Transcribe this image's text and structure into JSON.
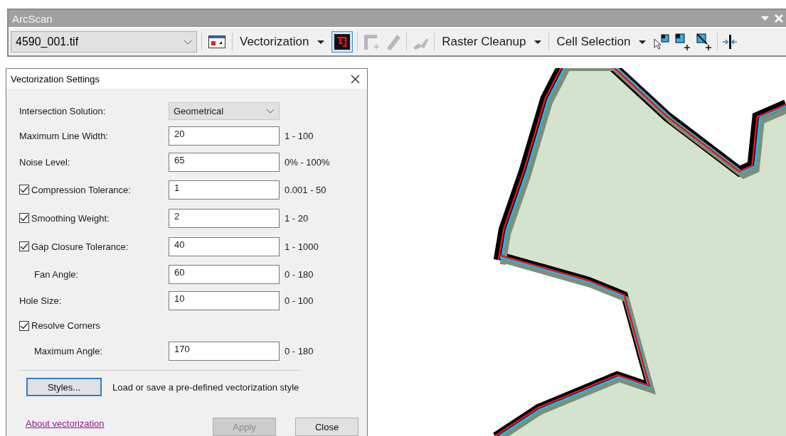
{
  "toolbar": {
    "title": "ArcScan",
    "raster": "4590_001.tif",
    "settings_button": {
      "selected": true
    },
    "menus": [
      {
        "label": "Vectorization"
      },
      {
        "label": "Raster Cleanup"
      },
      {
        "label": "Cell Selection"
      }
    ]
  },
  "dialog": {
    "title": "Vectorization Settings",
    "rows": [
      {
        "kind": "dropdown",
        "label": "Intersection Solution:",
        "value": "Geometrical"
      },
      {
        "kind": "field",
        "label": "Maximum Line Width:",
        "value": "20",
        "range": "1 - 100"
      },
      {
        "kind": "field",
        "label": "Noise Level:",
        "value": "65",
        "range": "0% - 100%"
      },
      {
        "kind": "field",
        "label": "Compression Tolerance:",
        "value": "1",
        "range": "0.001 - 50",
        "checked": true
      },
      {
        "kind": "field",
        "label": "Smoothing Weight:",
        "value": "2",
        "range": "1 - 20",
        "checked": true
      },
      {
        "kind": "field",
        "label": "Gap Closure Tolerance:",
        "value": "40",
        "range": "1 - 1000",
        "checked": true,
        "children": [
          {
            "kind": "field",
            "label": "Fan Angle:",
            "value": "60",
            "range": "0 - 180"
          }
        ]
      },
      {
        "kind": "field",
        "label": "Hole Size:",
        "value": "10",
        "range": "0 - 100"
      },
      {
        "kind": "checkbox",
        "label": "Resolve Corners",
        "checked": true,
        "children": [
          {
            "kind": "field",
            "label": "Maximum Angle:",
            "value": "170",
            "range": "0 - 180"
          }
        ]
      }
    ],
    "styles_button": "Styles...",
    "styles_hint": "Load or save a pre-defined vectorization style",
    "link": "About vectorization",
    "apply": {
      "label": "Apply",
      "disabled": true
    },
    "close": "Close"
  }
}
